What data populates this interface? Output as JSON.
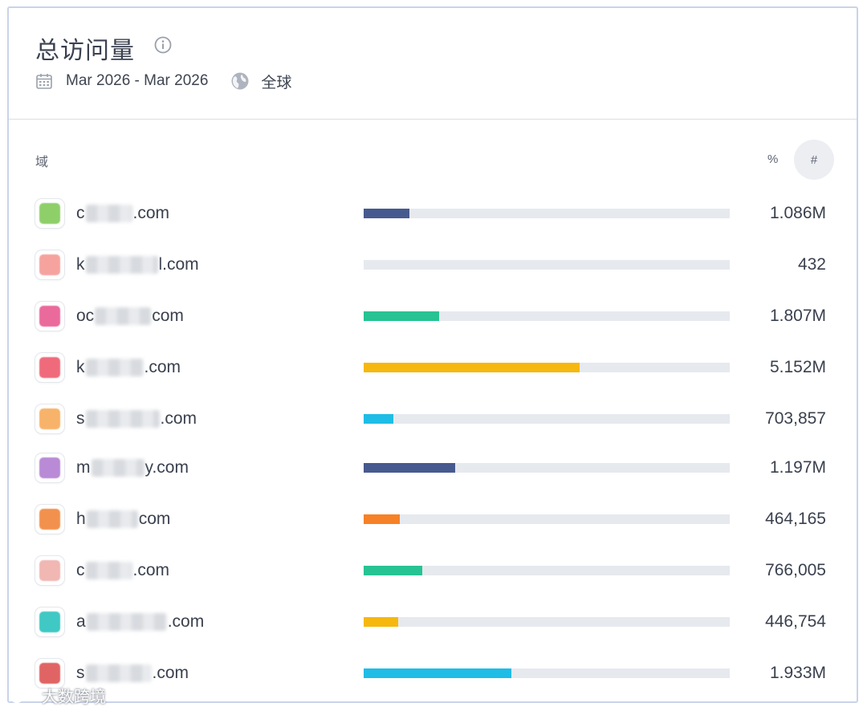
{
  "header": {
    "title": "总访问量",
    "date_range": "Mar 2026 - Mar 2026",
    "region": "全球"
  },
  "table": {
    "col_domain": "域",
    "col_percent": "%",
    "col_number": "#",
    "rows": [
      {
        "prefix": "c",
        "suffix": ".com",
        "value": "1.086M",
        "share": 0.125,
        "color": "#475a8f",
        "fav": "#8fcf6a"
      },
      {
        "prefix": "k",
        "suffix": "l.com",
        "value": "432",
        "share": 0.0,
        "color": "#475a8f",
        "fav": "#f6a3a0"
      },
      {
        "prefix": "oc",
        "suffix": "com",
        "value": "1.807M",
        "share": 0.207,
        "color": "#27c393",
        "fav": "#ea6a9c"
      },
      {
        "prefix": "k",
        "suffix": ".com",
        "value": "5.152M",
        "share": 0.59,
        "color": "#f6b80e",
        "fav": "#ef6b7c"
      },
      {
        "prefix": "s",
        "suffix": ".com",
        "value": "703,857",
        "share": 0.081,
        "color": "#1ebde6",
        "fav": "#f8b36a"
      },
      {
        "prefix": "m",
        "suffix": "y.com",
        "value": "1.197M",
        "share": 0.249,
        "color": "#475a8f",
        "fav": "#b98ad6"
      },
      {
        "prefix": "h",
        "suffix": "com",
        "value": "464,165",
        "share": 0.098,
        "color": "#f78126",
        "fav": "#f2914d"
      },
      {
        "prefix": "c",
        "suffix": ".com",
        "value": "766,005",
        "share": 0.161,
        "color": "#27c393",
        "fav": "#f1b7b2"
      },
      {
        "prefix": "a",
        "suffix": ".com",
        "value": "446,754",
        "share": 0.094,
        "color": "#f6b80e",
        "fav": "#3fc8c4"
      },
      {
        "prefix": "s",
        "suffix": ".com",
        "value": "1.933M",
        "share": 0.404,
        "color": "#1ebde6",
        "fav": "#e06464"
      }
    ]
  },
  "watermark": "大数跨境",
  "icons": {
    "info": "info-icon",
    "calendar": "calendar-icon",
    "globe": "globe-icon"
  }
}
